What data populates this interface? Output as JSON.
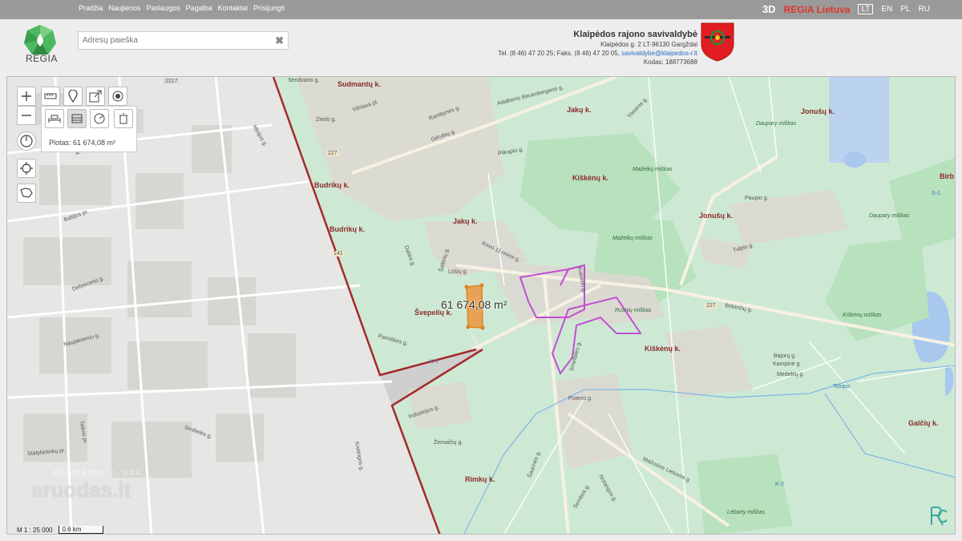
{
  "nav": {
    "items": [
      "Pradžia",
      "Naujienos",
      "Paslaugos",
      "Pagalba",
      "Kontaktai",
      "Prisijungti"
    ],
    "btn_3d": "3D",
    "regia_lietuva": "REGIA Lietuva",
    "languages": [
      "LT",
      "EN",
      "PL",
      "RU"
    ],
    "active_language": "LT"
  },
  "header": {
    "logo_text": "REGIA",
    "search_placeholder": "Adresų paieška",
    "search_clear": "✖",
    "municipality": {
      "name": "Klaipėdos rajono savivaldybė",
      "address": "Klaipėdos g. 2 LT-96130 Gargždai",
      "phone": "Tel. (8 46) 47 20 25; Faks. (8 46) 47 20 05,",
      "email": "savivaldybe@klaipedos-r.lt",
      "code": "Kodas: 188773688"
    }
  },
  "map": {
    "measure_result": "Plotas: 61 674,08 m²",
    "area_label": "61 674,08 m²",
    "scale_ratio": "M 1 : 25 000",
    "scale_bar": "0.6 km",
    "watermark": "aruodas.lt",
    "watermark_sub": "Klaipėdos r. sav.",
    "places": [
      "Sudmantų k.",
      "Jakų k.",
      "Jonušų k.",
      "Budrikų k.",
      "Kiškėnų k.",
      "Jakų k.",
      "Jonušų k.",
      "Budrikų k.",
      "Švepelių k.",
      "Kiškėnų k.",
      "Galčių k.",
      "Rimkų k.",
      "Birb"
    ],
    "streets": [
      "Sendvario g.",
      "Vilniaus pl.",
      "Ziedo g.",
      "Adalberto Becenbergerio g.",
      "Rambynės g.",
      "Gėrybių g.",
      "Pilkapio g.",
      "Vasaros g.",
      "Kovo 11-osios g.",
      "Šaltinių g.",
      "Daliės g.",
      "Lūšių g.",
      "Pamiškės g.",
      "Industrijos g.",
      "Žemaičių g.",
      "Kalnelio g.",
      "Birbinčių g.",
      "Paupio g.",
      "Tulpio g.",
      "Bajorų g.",
      "Kampinė g.",
      "Medeklų g.",
      "Mažosios Lietuvos g.",
      "Tolupis",
      "Smeltalės g.",
      "Šaurinės g.",
      "Sembos g.",
      "Notangos g.",
      "Puteno g.",
      "Šilutės pl.",
      "Baltijos pr.",
      "Debreceno g.",
      "Naujakiemio g.",
      "Taikos pr.",
      "Smiltelės g.",
      "Statybininkų pr.",
      "Minijos g.",
      "Kretingos g."
    ],
    "forests": [
      "Daupary miškas",
      "Mažeikų miškas",
      "Mažeikų miškas",
      "Daupary miškas",
      "Kiškėnų miškas",
      "Rusnių miškas",
      "Lėbarty miškas"
    ],
    "road_numbers": [
      "227",
      "2217",
      "227",
      "141",
      "K-1",
      "K-2",
      "S-1"
    ]
  }
}
